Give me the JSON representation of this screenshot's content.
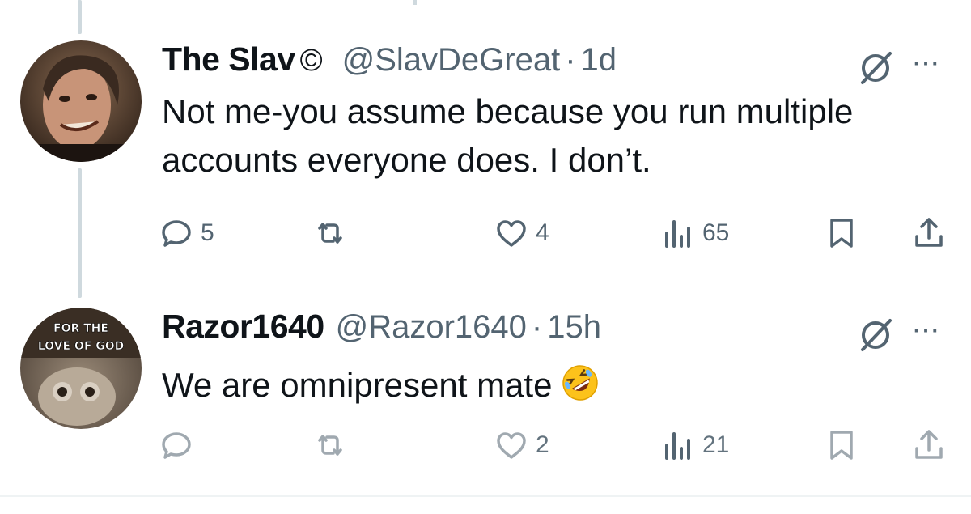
{
  "tweets": [
    {
      "author": {
        "name": "The Slav",
        "badge": "©",
        "handle": "@SlavDeGreat",
        "time": "1d",
        "avatar_icon": "avatar-man-smiling"
      },
      "text": "Not me-you assume because you run multiple accounts everyone does. I don’t.",
      "stats": {
        "replies": "5",
        "reposts": "",
        "likes": "4",
        "views": "65"
      }
    },
    {
      "author": {
        "name": "Razor1640",
        "handle": "@Razor1640",
        "time": "15h",
        "avatar_caption_line1": "FOR THE",
        "avatar_caption_line2": "LOVE OF GOD",
        "avatar_icon": "avatar-owl-meme"
      },
      "text": "We are omnipresent mate",
      "text_emoji": "rolling-on-floor-laughing-icon",
      "stats": {
        "replies": "",
        "reposts": "",
        "likes": "2",
        "views": "21"
      }
    }
  ],
  "separator": "·",
  "more_label": "···",
  "colors": {
    "text": "#0f1419",
    "muted": "#536471",
    "thread": "#cfd9de"
  }
}
